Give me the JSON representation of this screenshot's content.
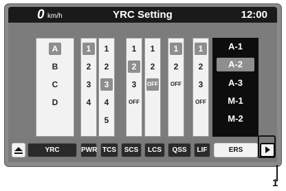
{
  "status_bar": {
    "speed_value": "0",
    "speed_unit": "km/h",
    "title": "YRC Setting",
    "clock": "12:00"
  },
  "settings": {
    "column_A": {
      "items": [
        "A",
        "B",
        "C",
        "D"
      ],
      "selected": "A"
    },
    "column_1": {
      "items": [
        "1",
        "2",
        "3",
        "4"
      ],
      "selected": "1"
    },
    "column_2": {
      "items": [
        "1",
        "2",
        "3",
        "4",
        "5"
      ],
      "selected": "3"
    },
    "column_3": {
      "items": [
        "1",
        "2",
        "3",
        "OFF"
      ],
      "selected": "2"
    },
    "column_4": {
      "items": [
        "1",
        "2",
        "OFF"
      ],
      "selected": "OFF"
    },
    "column_5": {
      "items": [
        "1",
        "2",
        "OFF"
      ],
      "selected": "1"
    },
    "column_6": {
      "items": [
        "1",
        "2",
        "3",
        "OFF"
      ],
      "selected": "1"
    }
  },
  "mode_list": {
    "items": [
      "A-1",
      "A-2",
      "A-3",
      "M-1",
      "M-2"
    ],
    "selected": "A-2"
  },
  "bottom_bar": {
    "eject_icon": "eject-icon",
    "yrc": "YRC",
    "pwr": "PWR",
    "tcs": "TCS",
    "scs": "SCS",
    "lcs": "LCS",
    "qss": "QSS",
    "lif": "LIF",
    "ers": "ERS",
    "next_icon": "right-arrow-icon"
  },
  "callout": {
    "number": "1"
  }
}
